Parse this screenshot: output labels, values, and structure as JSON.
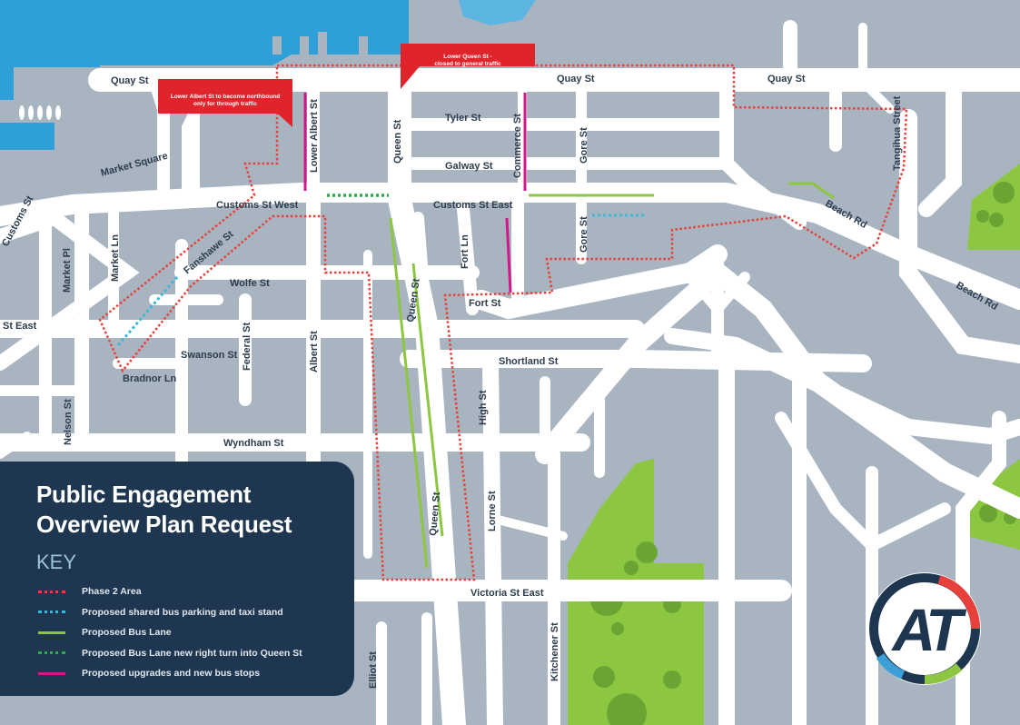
{
  "streets": [
    "Quay St",
    "Quay St",
    "Quay St",
    "Tyler St",
    "Galway St",
    "Customs St West",
    "Customs St East",
    "Customs St",
    "Market Square",
    "Lower Albert St",
    "Queen St",
    "Commerce St",
    "Gore St",
    "Gore St",
    "Tangihua Street",
    "Beach Rd",
    "Beach Rd",
    "Market Pl",
    "Market Ln",
    "Fanshawe St",
    "Wolfe St",
    "St East",
    "Fort Ln",
    "Fort St",
    "Queen St",
    "Swanson St",
    "Federal St",
    "Albert St",
    "Shortland St",
    "Bradnor Ln",
    "High St",
    "Nelson St",
    "Wyndham St",
    "Queen St",
    "Lorne St",
    "Victoria St East",
    "Kitchener St",
    "Elliot St"
  ],
  "callouts": {
    "queen": "Lower Queen St - closed to general traffic",
    "albert": "Lower Albert St to become northbound only for through traffic"
  },
  "panel": {
    "title_line1": "Public Engagement",
    "title_line2": "Overview Plan Request",
    "key_heading": "KEY"
  },
  "key": [
    {
      "label": "Phase 2 Area",
      "color": "#e8403a",
      "style": "dotted"
    },
    {
      "label": "Proposed shared bus parking and taxi stand",
      "color": "#3bb7d8",
      "style": "dotted"
    },
    {
      "label": "Proposed Bus Lane",
      "color": "#8dc641",
      "style": "solid"
    },
    {
      "label": "Proposed Bus Lane new right turn into Queen St",
      "color": "#2cae4f",
      "style": "dotted"
    },
    {
      "label": "Proposed upgrades and new bus stops",
      "color": "#d1188a",
      "style": "solid"
    }
  ],
  "logo": {
    "text": "AT",
    "ring_colors": [
      "#1f3650",
      "#e8403a",
      "#8dc641",
      "#3c9fd6"
    ]
  },
  "colors": {
    "water": "#2f9fd8",
    "land": "#a8b4c0",
    "road": "#ffffff",
    "park": "#8dc641",
    "panel": "#1f3650"
  }
}
